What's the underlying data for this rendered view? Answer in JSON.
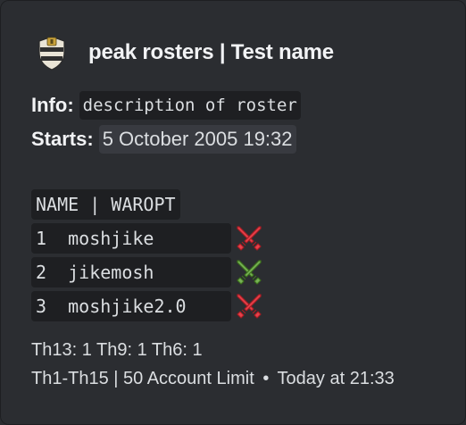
{
  "embed": {
    "author_name": "peak rosters | Test name",
    "author_icon": "shield-badge-icon",
    "info_label": "Info:",
    "info_value": "description of roster",
    "starts_label": "Starts:",
    "starts_value": "5 October 2005 19:32",
    "table_header": "NAME | WAROPT",
    "rows": [
      {
        "text": "1  moshjike",
        "war_opt": "out",
        "icon": "crossed-swords-red-icon"
      },
      {
        "text": "2  jikemosh",
        "war_opt": "in",
        "icon": "crossed-swords-green-icon"
      },
      {
        "text": "3  moshjike2.0",
        "war_opt": "out",
        "icon": "crossed-swords-red-icon"
      }
    ],
    "th_summary": "Th13: 1 Th9: 1 Th6: 1",
    "footer_text": "Th1-Th15 | 50 Account Limit",
    "footer_separator": "•",
    "timestamp": "Today at 21:33"
  },
  "colors": {
    "background": "#2b2d31",
    "code_background": "#1e1f22",
    "timestamp_background": "#383a40",
    "text": "#dbdee1",
    "heading": "#f2f3f5",
    "war_out": "#e8414b",
    "war_in": "#77b255"
  }
}
